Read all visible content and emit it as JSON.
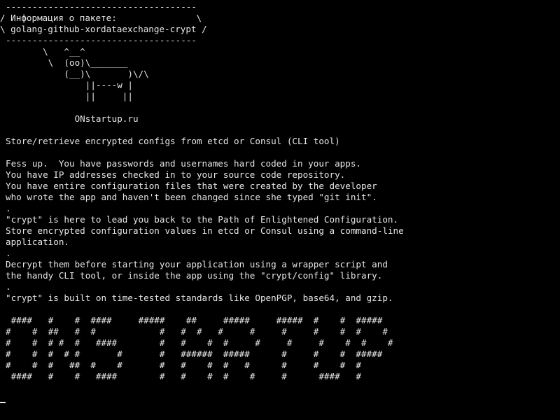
{
  "theme": {
    "background": "#000000",
    "foreground": "#e6e6e6"
  },
  "cowsay": {
    "bubble_top": "------------------------------------",
    "bubble_line1": "/ Информация о пакете:               \\",
    "bubble_line2": "\\ golang-github-xordataexchange-crypt /",
    "bubble_bottom": "------------------------------------",
    "cow": [
      "       \\   ^__^",
      "        \\  (oo)\\_______",
      "           (__)\\       )\\/\\",
      "               ||----w |",
      "               ||     ||"
    ],
    "site": "             ONstartup.ru"
  },
  "description": {
    "summary": "Store/retrieve encrypted configs from etcd or Consul (CLI tool)",
    "paragraphs": [
      "Fess up.  You have passwords and usernames hard coded in your apps.",
      "You have IP addresses checked in to your source code repository.",
      "You have entire configuration files that were created by the developer",
      "who wrote the app and haven't been changed since she typed \"git init\".",
      ".",
      "\"crypt\" is here to lead you back to the Path of Enlightened Configuration.",
      "Store encrypted configuration values in etcd or Consul using a command-line",
      "application.",
      ".",
      "Decrypt them before starting your application using a wrapper script and",
      "the handy CLI tool, or inside the app using the \"crypt/config\" library.",
      ".",
      "\"crypt\" is built on time-tested standards like OpenPGP, base64, and gzip."
    ]
  },
  "banner": [
    " ####   #    #  ####     #####    ##     #####     #####  #    #  #####",
    "#    #  ##   #  #            #   #  #   #     #     #     #    #  #    #",
    "#    #  # #  #   ####        #   #    #  #     #     #     #    #  #    #",
    "#    #  #  # #       #       #   ######  #####      #     #    #  #####",
    "#    #  #   ##  #    #       #   #    #  #   #      #     #    #  #",
    " ####   #    #   ####        #   #    #  #    #     #      ####   #"
  ]
}
